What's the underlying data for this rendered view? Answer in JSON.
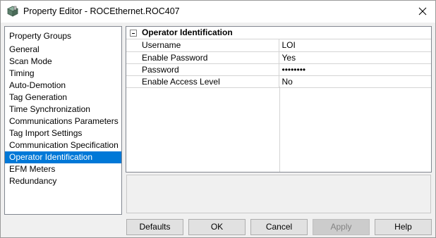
{
  "window": {
    "title": "Property Editor - ROCEthernet.ROC407",
    "icon": "property-editor-icon",
    "close_icon": "close-icon"
  },
  "property_groups": {
    "header": "Property Groups",
    "items": [
      {
        "label": "General",
        "selected": false
      },
      {
        "label": "Scan Mode",
        "selected": false
      },
      {
        "label": "Timing",
        "selected": false
      },
      {
        "label": "Auto-Demotion",
        "selected": false
      },
      {
        "label": "Tag Generation",
        "selected": false
      },
      {
        "label": "Time Synchronization",
        "selected": false
      },
      {
        "label": "Communications Parameters",
        "selected": false
      },
      {
        "label": "Tag Import Settings",
        "selected": false
      },
      {
        "label": "Communication Specification",
        "selected": false
      },
      {
        "label": "Operator Identification",
        "selected": true
      },
      {
        "label": "EFM Meters",
        "selected": false
      },
      {
        "label": "Redundancy",
        "selected": false
      }
    ]
  },
  "properties": {
    "section_title": "Operator Identification",
    "collapse_icon": "collapse-minus-icon",
    "rows": [
      {
        "name": "Username",
        "value": "LOI"
      },
      {
        "name": "Enable Password",
        "value": "Yes"
      },
      {
        "name": "Password",
        "value": "••••••••"
      },
      {
        "name": "Enable Access Level",
        "value": "No"
      }
    ]
  },
  "description": {
    "text": ""
  },
  "buttons": {
    "defaults": "Defaults",
    "ok": "OK",
    "cancel": "Cancel",
    "apply": "Apply",
    "apply_enabled": false,
    "help": "Help"
  },
  "colors": {
    "selection": "#0078d7",
    "window_bg": "#f0f0f0",
    "grid_line": "#d4d4d4"
  }
}
